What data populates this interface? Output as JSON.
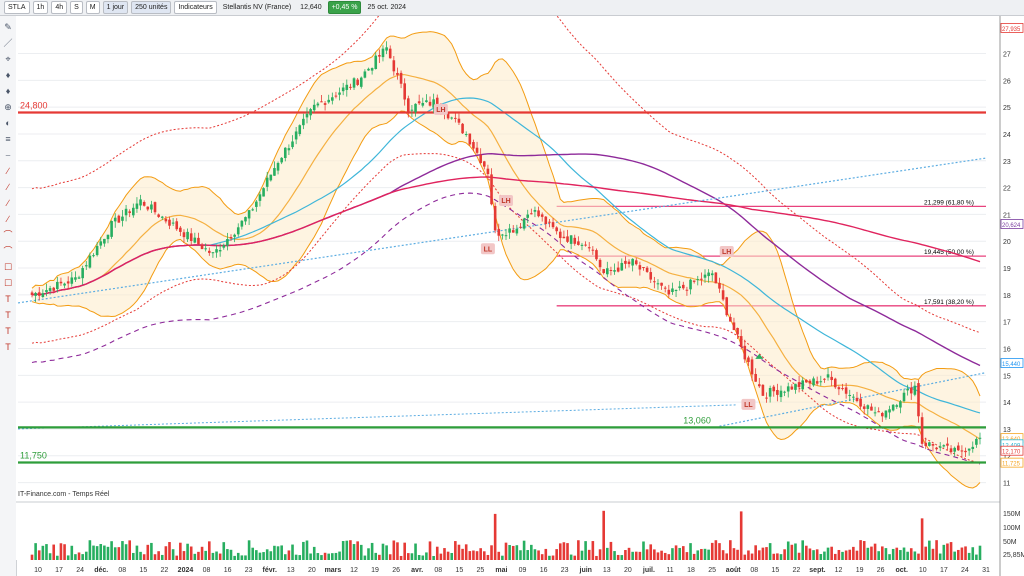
{
  "toolbar": {
    "symbol": "STLA",
    "intervals": [
      "1h",
      "4h",
      "S",
      "M"
    ],
    "period": "1 jour",
    "units": "250 unités",
    "indicators_label": "Indicateurs",
    "instrument": "Stellantis NV (France)",
    "price": "12,640",
    "change": "+0,45 %",
    "date": "25 oct. 2024"
  },
  "chart_data": {
    "type": "candlestick",
    "source": "IT-Finance.com - Temps Réel",
    "price_ticks": [
      11,
      12,
      13,
      14,
      15,
      16,
      17,
      18,
      19,
      20,
      21,
      22,
      23,
      24,
      25,
      26,
      27
    ],
    "ylim": [
      10.5,
      28.1
    ],
    "volume_ticks": [
      "150M",
      "100M",
      "50M",
      "25,85M"
    ],
    "x_ticks": [
      "10",
      "17",
      "24",
      "déc.",
      "08",
      "15",
      "22",
      "2024",
      "08",
      "16",
      "23",
      "févr.",
      "13",
      "20",
      "mars",
      "12",
      "19",
      "26",
      "avr.",
      "08",
      "15",
      "25",
      "mai",
      "09",
      "16",
      "23",
      "juin",
      "13",
      "20",
      "juil.",
      "11",
      "18",
      "25",
      "août",
      "08",
      "15",
      "22",
      "sept.",
      "12",
      "19",
      "26",
      "oct.",
      "10",
      "17",
      "24",
      "31"
    ],
    "horizontal_levels": [
      {
        "value": 24.8,
        "label": "24,800",
        "color": "#e53935"
      },
      {
        "value": 13.06,
        "label": "13,060",
        "color": "#2e9d3a"
      },
      {
        "value": 11.75,
        "label": "11,750",
        "color": "#2e9d3a"
      }
    ],
    "fibonacci": [
      {
        "value": 21.299,
        "label": "21,299 (61,80 %)"
      },
      {
        "value": 19.445,
        "label": "19,445 (50,00 %)"
      },
      {
        "value": 17.591,
        "label": "17,591 (38,20 %)"
      }
    ],
    "price_tags": [
      {
        "value": 27.935,
        "text": "27,935",
        "color": "#e53935"
      },
      {
        "value": 20.624,
        "text": "20,624",
        "color": "#7b3fa0"
      },
      {
        "value": 15.44,
        "text": "15,440",
        "color": "#2196f3"
      },
      {
        "value": 12.64,
        "text": "12,640",
        "color": "#f5a623"
      },
      {
        "value": 12.409,
        "text": "12,409",
        "color": "#29b6d6"
      },
      {
        "value": 12.17,
        "text": "12,170",
        "color": "#e53935"
      },
      {
        "value": 11.725,
        "text": "11,725",
        "color": "#f5a623"
      }
    ],
    "annotations": [
      "LH",
      "LH",
      "LL",
      "LH",
      "LL"
    ],
    "anchor_points": [
      {
        "t": 0,
        "v": 18.0
      },
      {
        "t": 12,
        "v": 18.6
      },
      {
        "t": 22,
        "v": 20.6
      },
      {
        "t": 30,
        "v": 21.5
      },
      {
        "t": 40,
        "v": 20.5
      },
      {
        "t": 50,
        "v": 19.5
      },
      {
        "t": 60,
        "v": 21.0
      },
      {
        "t": 68,
        "v": 23.0
      },
      {
        "t": 78,
        "v": 25.0
      },
      {
        "t": 90,
        "v": 26.0
      },
      {
        "t": 98,
        "v": 27.2
      },
      {
        "t": 104,
        "v": 25.0
      },
      {
        "t": 112,
        "v": 25.2
      },
      {
        "t": 120,
        "v": 24.0
      },
      {
        "t": 126,
        "v": 22.6
      },
      {
        "t": 128,
        "v": 20.3
      },
      {
        "t": 134,
        "v": 20.5
      },
      {
        "t": 138,
        "v": 21.2
      },
      {
        "t": 146,
        "v": 20.2
      },
      {
        "t": 154,
        "v": 19.9
      },
      {
        "t": 158,
        "v": 18.8
      },
      {
        "t": 166,
        "v": 19.2
      },
      {
        "t": 176,
        "v": 18.0
      },
      {
        "t": 188,
        "v": 18.8
      },
      {
        "t": 196,
        "v": 16.0
      },
      {
        "t": 202,
        "v": 14.3
      },
      {
        "t": 214,
        "v": 14.7
      },
      {
        "t": 220,
        "v": 14.9
      },
      {
        "t": 234,
        "v": 13.5
      },
      {
        "t": 244,
        "v": 14.6
      },
      {
        "t": 246,
        "v": 12.5
      },
      {
        "t": 256,
        "v": 12.1
      },
      {
        "t": 262,
        "v": 12.64
      }
    ],
    "total_sessions": 263
  }
}
